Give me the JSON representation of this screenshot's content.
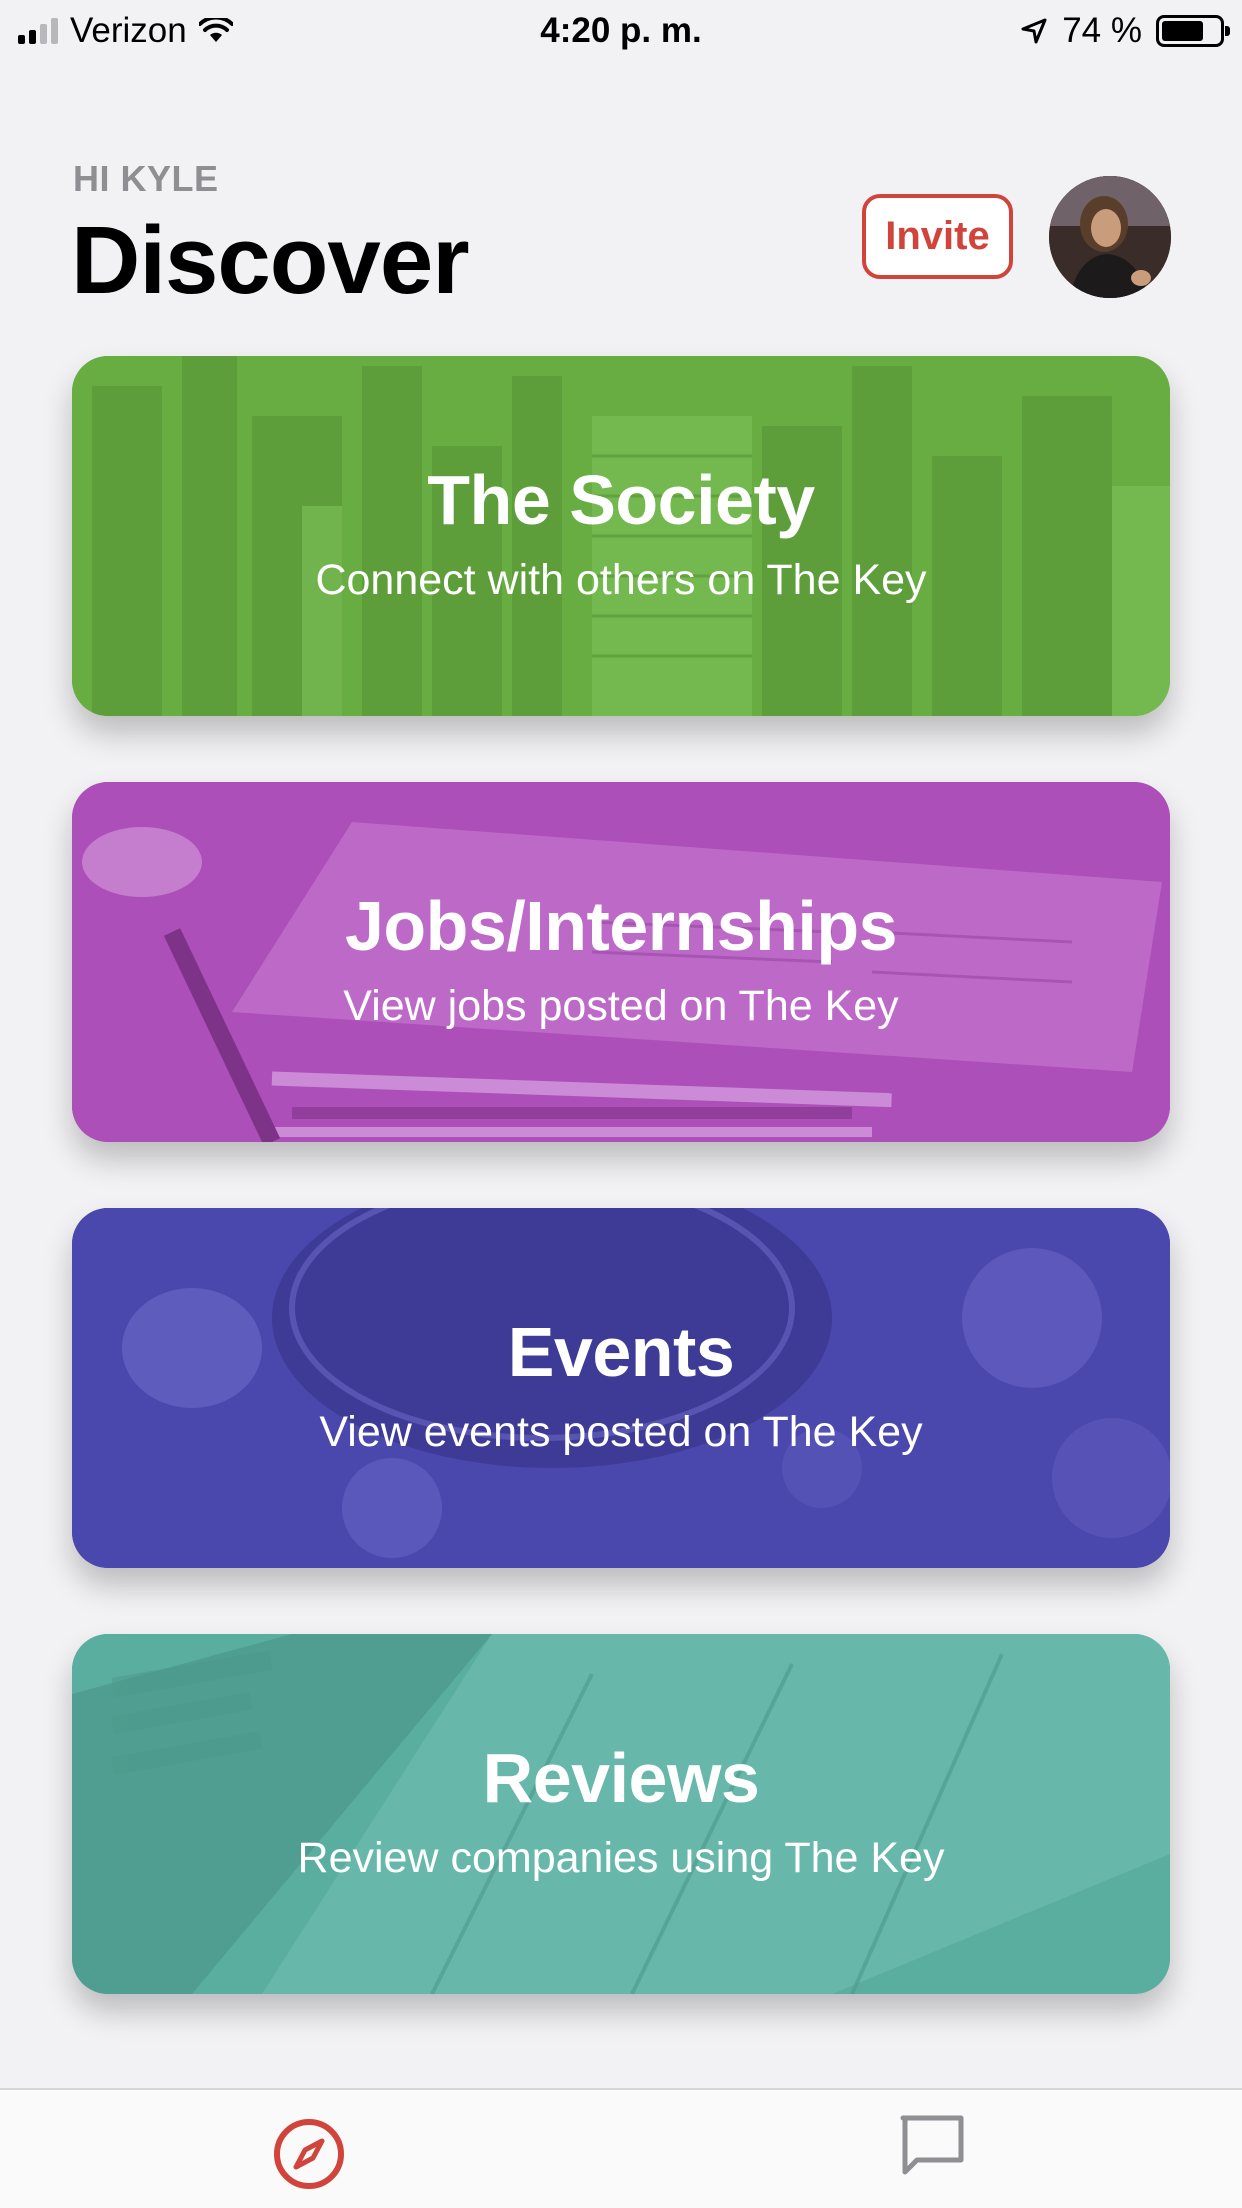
{
  "status_bar": {
    "carrier": "Verizon",
    "time": "4:20 p. m.",
    "battery": "74 %",
    "battery_level": 0.74
  },
  "header": {
    "greeting": "HI KYLE",
    "title": "Discover",
    "invite_label": "Invite"
  },
  "cards": [
    {
      "title": "The Society",
      "subtitle": "Connect with others on The Key",
      "color": "#67ad42"
    },
    {
      "title": "Jobs/Internships",
      "subtitle": "View jobs posted on The Key",
      "color": "#ad4fb8"
    },
    {
      "title": "Events",
      "subtitle": "View events posted on The Key",
      "color": "#4a47ad"
    },
    {
      "title": "Reviews",
      "subtitle": "Review companies using The Key",
      "color": "#5aaea0"
    }
  ],
  "tab_bar": {
    "items": [
      {
        "icon": "compass-icon",
        "active": true
      },
      {
        "icon": "chat-bubble-icon",
        "active": false
      }
    ],
    "accent": "#d0443c",
    "inactive": "#8e8e93"
  }
}
